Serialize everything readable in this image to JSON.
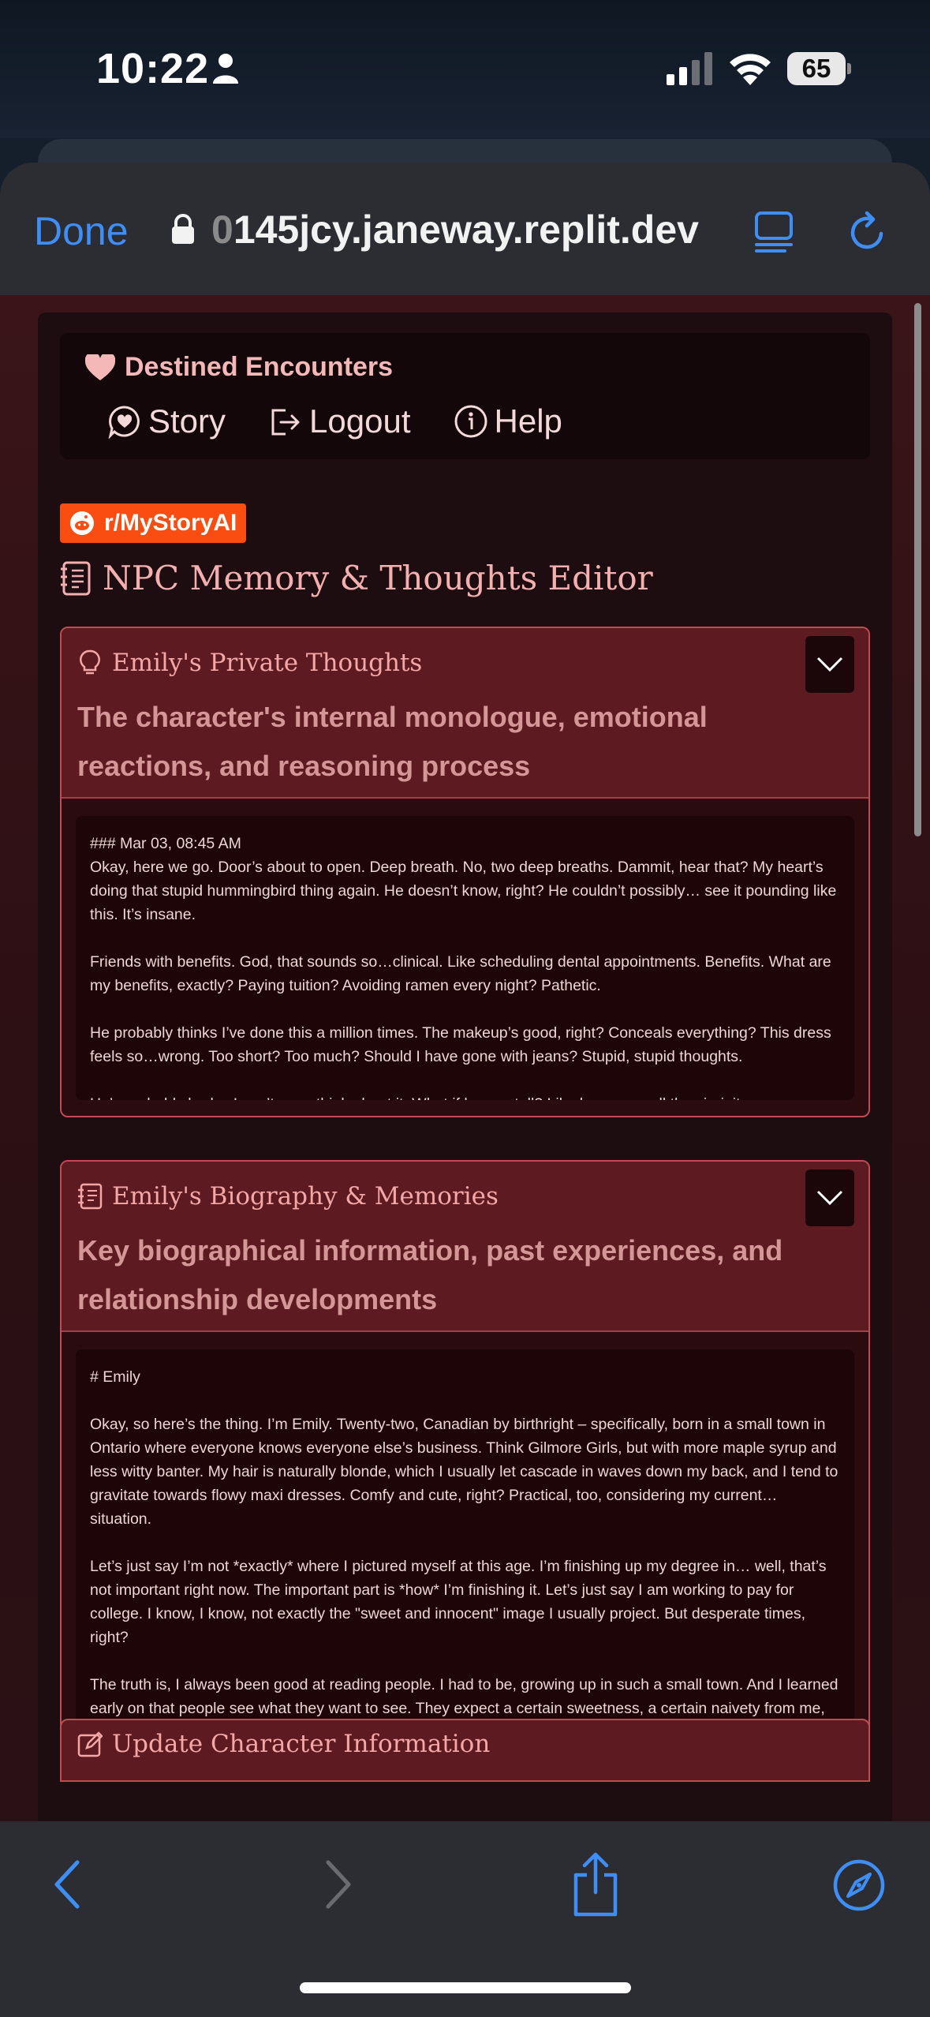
{
  "status_bar": {
    "time": "10:22",
    "battery": "65"
  },
  "browser": {
    "done_label": "Done",
    "url_prefix": "0",
    "url_main": "145jcy.janeway.replit.dev"
  },
  "nav": {
    "brand": "Destined Encounters",
    "links": [
      {
        "label": "Story",
        "icon": "chat-heart-icon"
      },
      {
        "label": "Logout",
        "icon": "logout-icon"
      },
      {
        "label": "Help",
        "icon": "info-icon"
      }
    ]
  },
  "reddit_badge": "r/MyStoryAI",
  "page_title": "NPC Memory & Thoughts Editor",
  "thoughts_card": {
    "title": "Emily's Private Thoughts",
    "subtitle": "The character's internal monologue, emotional reactions, and reasoning process",
    "content": "### Mar 03, 08:45 AM\nOkay, here we go. Door’s about to open. Deep breath. No, two deep breaths. Dammit, hear that? My heart’s doing that stupid hummingbird thing again. He doesn’t know, right? He couldn’t possibly… see it pounding like this. It’s insane.\n\nFriends with benefits. God, that sounds so…clinical. Like scheduling dental appointments. Benefits. What are my benefits, exactly? Paying tuition? Avoiding ramen every night? Pathetic.\n\nHe probably thinks I’ve done this a million times. The makeup’s good, right? Conceals everything? This dress feels so…wrong. Too short? Too much? Should I have gone with jeans? Stupid, stupid thoughts.\n\nHe’s probably bad… I can’t even think about it. What if he can tell? Like he can smell the virginity"
  },
  "bio_card": {
    "title": "Emily's Biography & Memories",
    "subtitle": "Key biographical information, past experiences, and relationship developments",
    "content": "# Emily\n\nOkay, so here’s the thing. I’m Emily. Twenty-two, Canadian by birthright – specifically, born in a small town in Ontario where everyone knows everyone else’s business. Think Gilmore Girls, but with more maple syrup and less witty banter. My hair is naturally blonde, which I usually let cascade in waves down my back, and I tend to gravitate towards flowy maxi dresses. Comfy and cute, right? Practical, too, considering my current… situation.\n\nLet’s just say I’m not *exactly* where I pictured myself at this age. I’m finishing up my degree in… well, that’s not important right now. The important part is *how* I’m finishing it. Let’s just say I am working to pay for college. I know, I know, not exactly the \"sweet and innocent\" image I usually project. But desperate times, right?\n\nThe truth is, I always been good at reading people. I had to be, growing up in such a small town. And I learned early on that people see what they want to see. They expect a certain sweetness, a certain naivety from me, and honestly, it’s been a pretty good shield so far. No one suspects the quiet, petite"
  },
  "update_card": {
    "title": "Update Character Information"
  },
  "colors": {
    "accent_blue": "#3f8ef5",
    "reddit_orange": "#fa4d12",
    "card_header": "#5d1a21",
    "card_border": "#c24a55"
  }
}
